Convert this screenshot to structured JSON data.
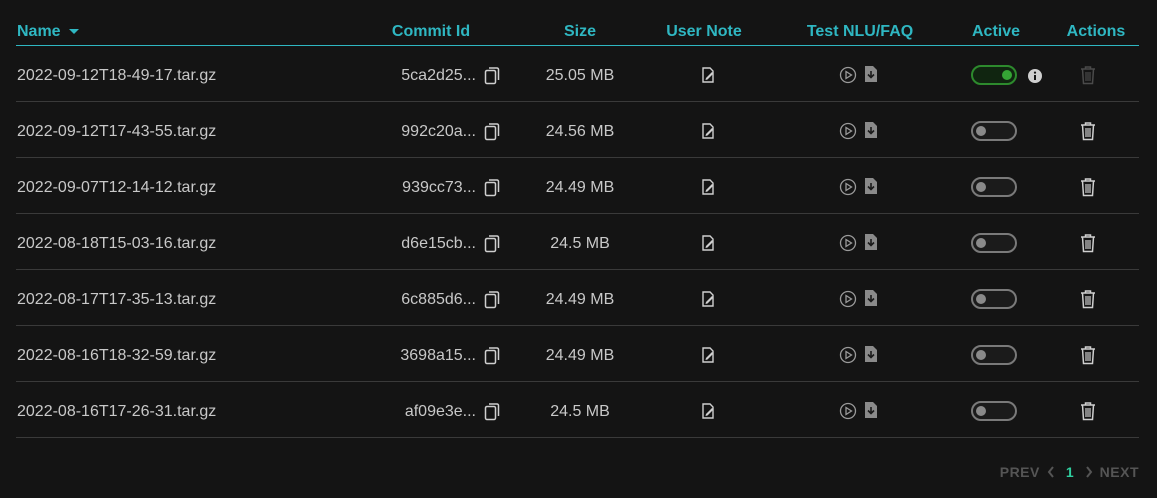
{
  "columns": {
    "name": "Name",
    "commit": "Commit Id",
    "size": "Size",
    "note": "User Note",
    "test": "Test NLU/FAQ",
    "active": "Active",
    "actions": "Actions"
  },
  "rows": [
    {
      "name": "2022-09-12T18-49-17.tar.gz",
      "commit": "5ca2d25...",
      "size": "25.05 MB",
      "active": true
    },
    {
      "name": "2022-09-12T17-43-55.tar.gz",
      "commit": "992c20a...",
      "size": "24.56 MB",
      "active": false
    },
    {
      "name": "2022-09-07T12-14-12.tar.gz",
      "commit": "939cc73...",
      "size": "24.49 MB",
      "active": false
    },
    {
      "name": "2022-08-18T15-03-16.tar.gz",
      "commit": "d6e15cb...",
      "size": "24.5 MB",
      "active": false
    },
    {
      "name": "2022-08-17T17-35-13.tar.gz",
      "commit": "6c885d6...",
      "size": "24.49 MB",
      "active": false
    },
    {
      "name": "2022-08-16T18-32-59.tar.gz",
      "commit": "3698a15...",
      "size": "24.49 MB",
      "active": false
    },
    {
      "name": "2022-08-16T17-26-31.tar.gz",
      "commit": "af09e3e...",
      "size": "24.5 MB",
      "active": false
    }
  ],
  "pager": {
    "prev": "PREV",
    "page": "1",
    "next": "NEXT"
  },
  "colors": {
    "accent": "#2fb7c2",
    "toggle_on": "#35a535",
    "page_active": "#2fd0a0"
  },
  "icons": {
    "sort": "sort-desc-icon",
    "copy": "copy-icon",
    "note": "edit-note-icon",
    "play": "play-icon",
    "download": "download-file-icon",
    "info": "info-icon",
    "delete": "trash-icon"
  }
}
